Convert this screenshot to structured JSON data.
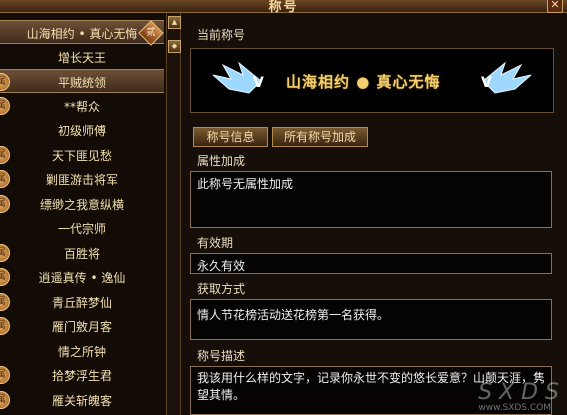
{
  "window": {
    "title": "称号",
    "close_label": "✕"
  },
  "list": {
    "items": [
      {
        "label": "山海相约 • 真心无悔",
        "badge": "",
        "badge_right": "贰",
        "selected": true
      },
      {
        "label": "增长天王",
        "badge": "",
        "badge_right": "",
        "selected": false
      },
      {
        "label": "平贼统领",
        "badge": "属",
        "badge_right": "",
        "selected": true
      },
      {
        "label": "**帮众",
        "badge": "属",
        "badge_right": "",
        "selected": false
      },
      {
        "label": "初级师傅",
        "badge": "",
        "badge_right": "",
        "selected": false
      },
      {
        "label": "天下匪见愁",
        "badge": "属",
        "badge_right": "",
        "selected": false
      },
      {
        "label": "剿匪游击将军",
        "badge": "属",
        "badge_right": "",
        "selected": false
      },
      {
        "label": "缥缈之我意纵横",
        "badge": "属",
        "badge_right": "",
        "selected": false
      },
      {
        "label": "一代宗师",
        "badge": "",
        "badge_right": "",
        "selected": false
      },
      {
        "label": "百胜将",
        "badge": "属",
        "badge_right": "",
        "selected": false
      },
      {
        "label": "逍遥真传 • 逸仙",
        "badge": "属",
        "badge_right": "",
        "selected": false
      },
      {
        "label": "青丘醉梦仙",
        "badge": "属",
        "badge_right": "",
        "selected": false
      },
      {
        "label": "雁门敫月客",
        "badge": "属",
        "badge_right": "",
        "selected": false
      },
      {
        "label": "情之所钟",
        "badge": "",
        "badge_right": "",
        "selected": false
      },
      {
        "label": "拾梦浮生君",
        "badge": "属",
        "badge_right": "",
        "selected": false
      },
      {
        "label": "雁关斩魄客",
        "badge": "属",
        "badge_right": "",
        "selected": false
      }
    ]
  },
  "panel": {
    "current_title_label": "当前称号",
    "current_title_name": "山海相约 ● 真心无悔",
    "tabs": [
      "称号信息",
      "所有称号加成"
    ],
    "attr_label": "属性加成",
    "attr_value": "此称号无属性加成",
    "validity_label": "有效期",
    "validity_value": "永久有效",
    "obtain_label": "获取方式",
    "obtain_value": "情人节花榜活动送花榜第一名获得。",
    "desc_label": "称号描述",
    "desc_value": "我该用什么样的文字，记录你永世不变的悠长爱意？山颠天涯，隽望其情。"
  },
  "watermark": {
    "text": "S X D S",
    "site": "www.SXDS.COM"
  },
  "colors": {
    "accent": "#f4d070",
    "border": "#8a7050"
  }
}
